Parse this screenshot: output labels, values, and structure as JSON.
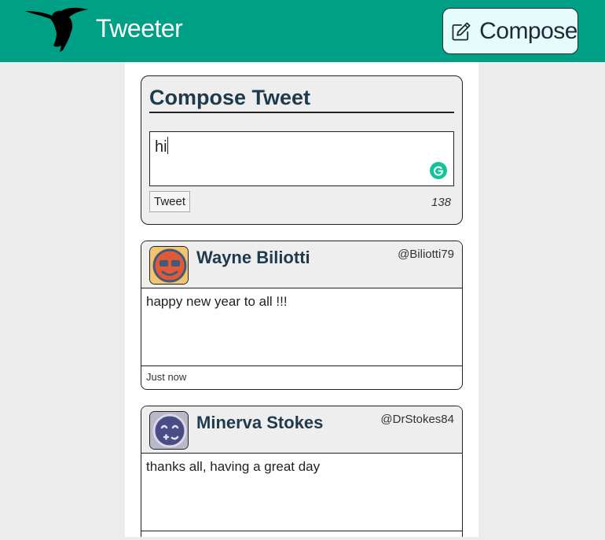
{
  "header": {
    "brand": "Tweeter",
    "logo_icon": "hummingbird-icon",
    "compose_label": "Compose",
    "compose_icon": "pencil-square-icon",
    "bg_color": "#00a087"
  },
  "compose": {
    "title": "Compose Tweet",
    "input_value": "hi",
    "grammarly_icon": "grammarly-icon",
    "tweet_button": "Tweet",
    "counter": "138"
  },
  "tweets": [
    {
      "name": "Wayne Biliotti",
      "handle": "@Biliotti79",
      "text": "happy new year to all !!!",
      "time": "Just now",
      "avatar_icon": "red-face-avatar-icon"
    },
    {
      "name": "Minerva Stokes",
      "handle": "@DrStokes84",
      "text": "thanks all, having a great day",
      "time": "",
      "avatar_icon": "purple-face-avatar-icon"
    }
  ]
}
